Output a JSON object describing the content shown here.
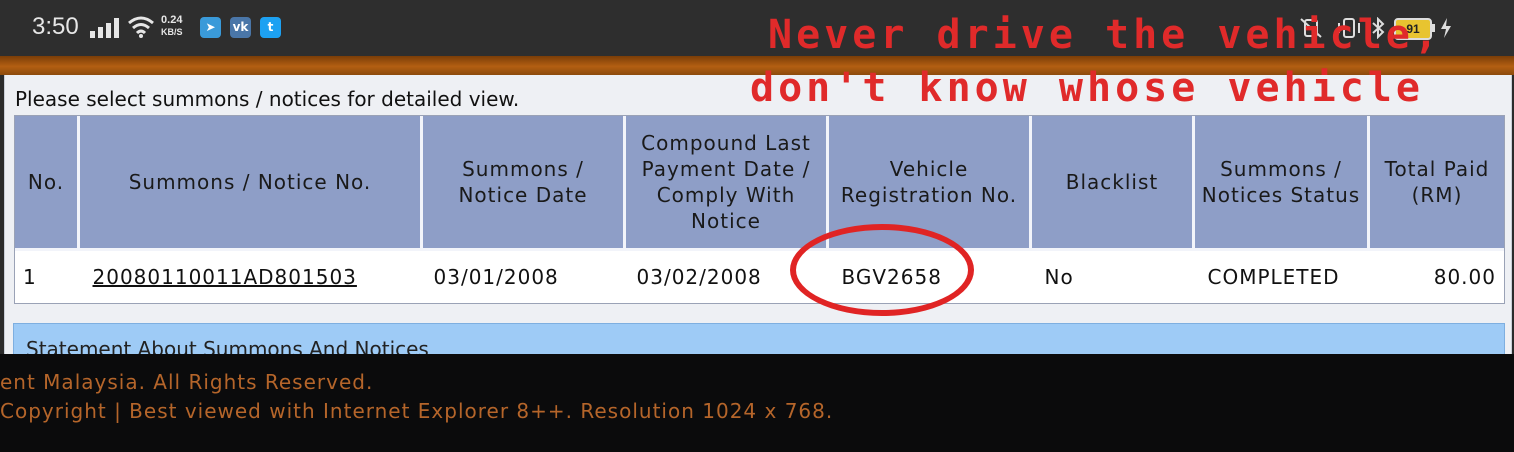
{
  "status_bar": {
    "time": "3:50",
    "net_speed_value": "0.24",
    "net_speed_unit": "KB/S",
    "battery_level": "91",
    "apps": [
      "telegram-icon",
      "vk-icon",
      "twitter-icon"
    ]
  },
  "page": {
    "intro": "Please select summons / notices for detailed view.",
    "table": {
      "headers": [
        "No.",
        "Summons / Notice No.",
        "Summons / Notice Date",
        "Compound Last Payment Date / Comply With Notice",
        "Vehicle Registration No.",
        "Blacklist",
        "Summons / Notices Status",
        "Total Paid (RM)"
      ],
      "rows": [
        {
          "no": "1",
          "summons_no": "20080110011AD801503",
          "summons_date": "03/01/2008",
          "last_payment_date": "03/02/2008",
          "vehicle_reg": "BGV2658",
          "blacklist": "No",
          "status": "COMPLETED",
          "total_paid": "80.00"
        }
      ]
    },
    "statement": "Statement About Summons And Notices"
  },
  "footer": {
    "line1": "ent Malaysia. All Rights Reserved.",
    "line2": "Copyright | Best viewed with Internet Explorer 8++. Resolution 1024 x 768."
  },
  "annotation": {
    "line1": "Never drive the vehicle,",
    "line2": "don't know whose vehicle"
  },
  "colors": {
    "annotation_red": "#e02a2a",
    "header_blue": "#8e9ec7",
    "footer_text": "#b5652a"
  }
}
